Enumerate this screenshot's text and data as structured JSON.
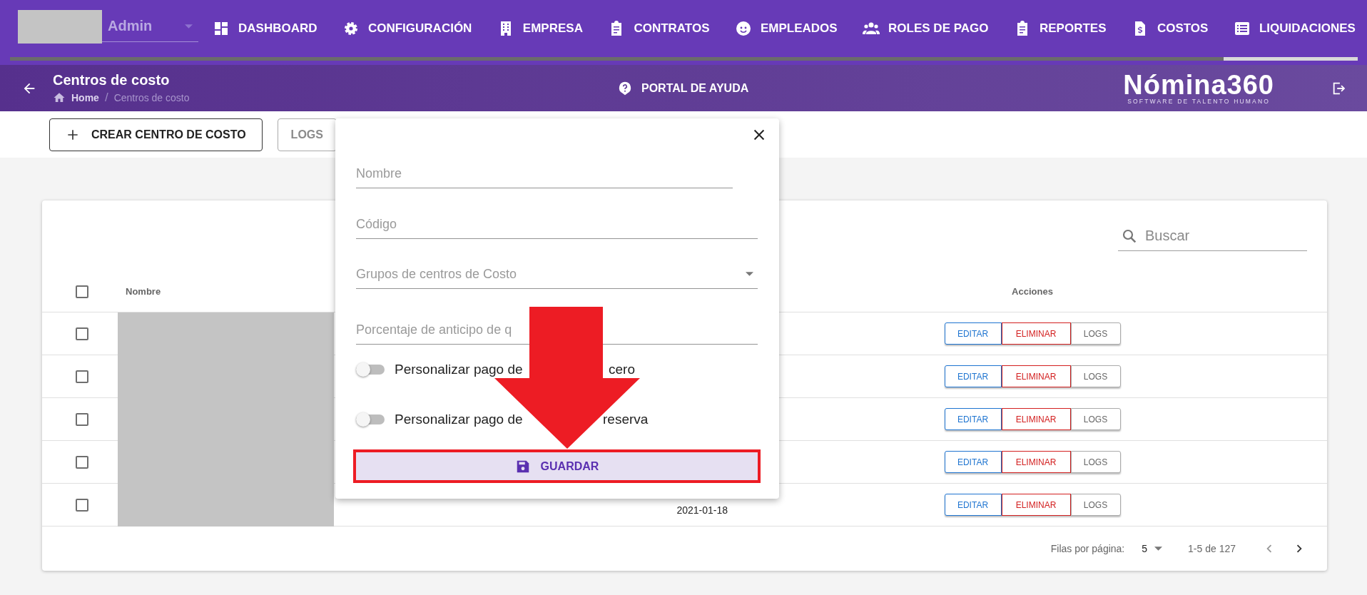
{
  "user": {
    "role": "Admin"
  },
  "nav": [
    {
      "label": "DASHBOARD",
      "selected": false
    },
    {
      "label": "CONFIGURACIÓN",
      "selected": false
    },
    {
      "label": "EMPRESA",
      "selected": false
    },
    {
      "label": "CONTRATOS",
      "selected": false
    },
    {
      "label": "EMPLEADOS",
      "selected": false
    },
    {
      "label": "ROLES DE PAGO",
      "selected": false
    },
    {
      "label": "REPORTES",
      "selected": false
    },
    {
      "label": "COSTOS",
      "selected": false
    },
    {
      "label": "LIQUIDACIONES",
      "selected": true
    }
  ],
  "header": {
    "title": "Centros de costo",
    "breadcrumb": [
      "Home",
      "Centros de costo"
    ],
    "separator": "/",
    "help": "PORTAL DE AYUDA",
    "logo": {
      "name": "Nómina360",
      "tagline": "SOFTWARE DE TALENTO HUMANO"
    }
  },
  "toolbar": {
    "buttons": [
      {
        "label": "CREAR CENTRO DE COSTO",
        "kind": "create"
      },
      {
        "label": "LOGS",
        "kind": "plain"
      }
    ]
  },
  "table": {
    "search": {
      "placeholder": "Buscar"
    },
    "all_checked": false,
    "columns": [
      "Nombre",
      "Acciones"
    ],
    "rows": [
      {
        "checked": false,
        "actions": [
          "EDITAR",
          "ELIMINAR",
          "LOGS"
        ]
      },
      {
        "checked": false,
        "actions": [
          "EDITAR",
          "ELIMINAR",
          "LOGS"
        ]
      },
      {
        "checked": false,
        "actions": [
          "EDITAR",
          "ELIMINAR",
          "LOGS"
        ]
      },
      {
        "checked": false,
        "actions": [
          "EDITAR",
          "ELIMINAR",
          "LOGS"
        ]
      },
      {
        "checked": false,
        "column_3": "2021-01-18",
        "actions": [
          "EDITAR",
          "ELIMINAR",
          "LOGS"
        ]
      }
    ],
    "footer": {
      "rows_per_page_label": "Filas por página:",
      "rows_per_page": "5",
      "range": "1-5 de 127"
    }
  },
  "dialog": {
    "fields": [
      {
        "placeholder": "Nombre",
        "kind": "text"
      },
      {
        "placeholder": "Código",
        "kind": "text"
      },
      {
        "placeholder": "Grupos de centros de Costo",
        "kind": "select"
      },
      {
        "placeholder": "Porcentaje de anticipo de q",
        "kind": "text"
      }
    ],
    "toggles": [
      {
        "label": "Personalizar pago de",
        "label_end": "cero",
        "on": false
      },
      {
        "label": "Personalizar pago de",
        "label_end": "reserva",
        "on": false
      }
    ],
    "save": "GUARDAR"
  }
}
